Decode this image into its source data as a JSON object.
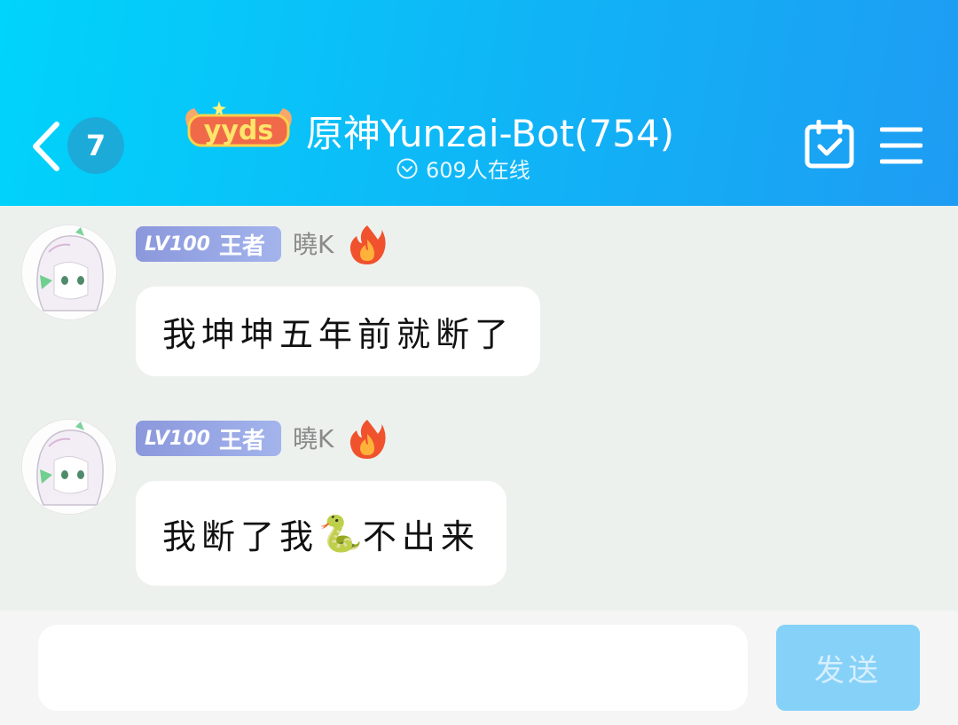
{
  "header": {
    "unread_count": "7",
    "logo_text": "yyds",
    "group_title": "原神Yunzai-Bot(754)",
    "online_text": "609人在线"
  },
  "messages": [
    {
      "level": "LV100",
      "rank": "王者",
      "nickname": "曉K",
      "text": "我坤坤五年前就断了"
    },
    {
      "level": "LV100",
      "rank": "王者",
      "nickname": "曉K",
      "text_before": "我断了我",
      "emoji": "🐍",
      "text_after": "不出来"
    }
  ],
  "input": {
    "value": "",
    "send_label": "发送"
  },
  "colors": {
    "header_start": "#00d4fb",
    "header_end": "#1e9cf3",
    "badge": "#8b98dc",
    "send_button": "#86d1f8",
    "chat_bg": "#edf1ee"
  }
}
